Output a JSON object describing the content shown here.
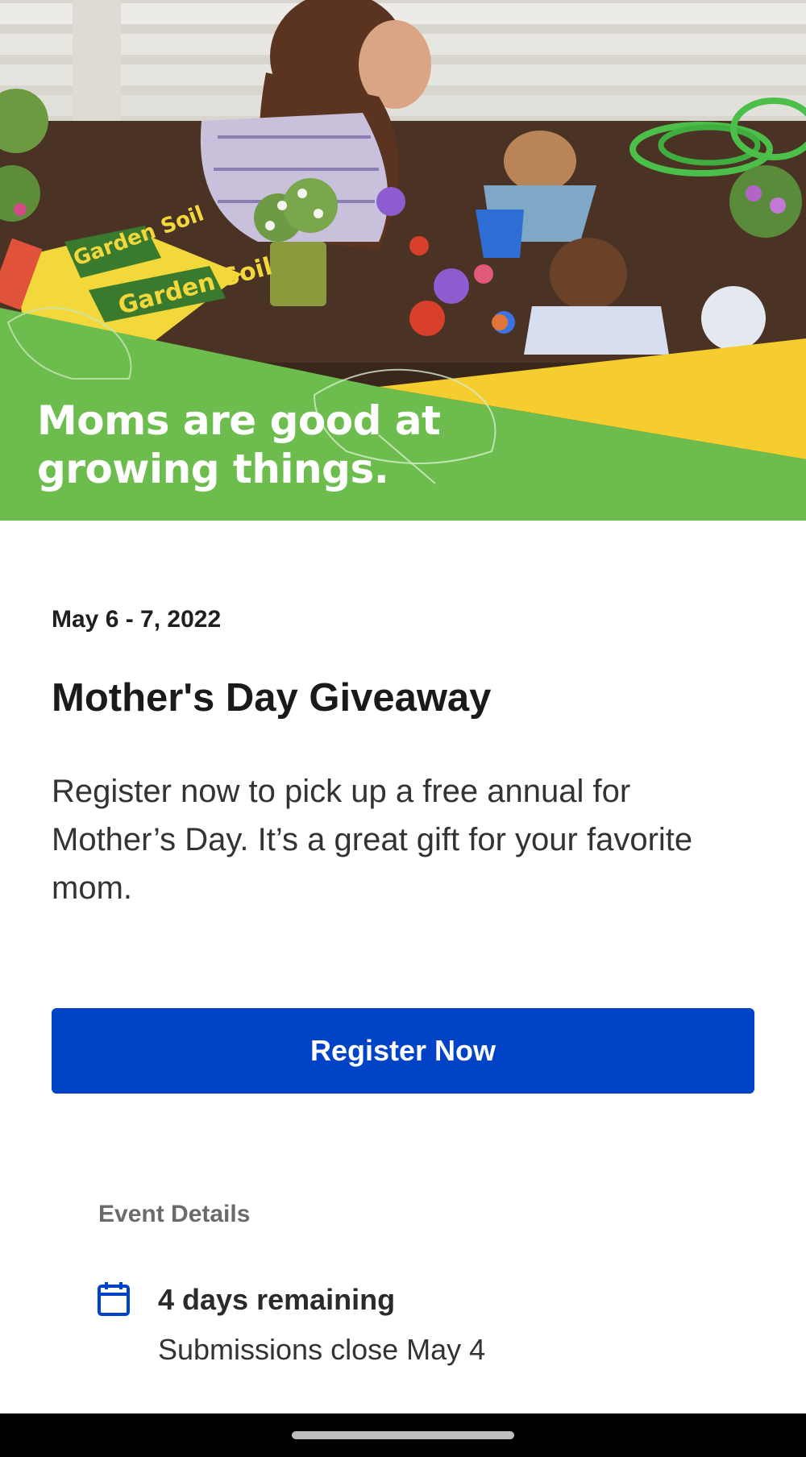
{
  "hero": {
    "headline_line1": "Moms are good at",
    "headline_line2": "growing things.",
    "bag_text_1": "Garden Soil",
    "bag_text_2": "Garden Soil"
  },
  "event": {
    "date": "May 6 - 7, 2022",
    "title": "Mother's Day Giveaway",
    "description": "Register now to pick up a free annual for Mother’s Day. It’s a great gift for your favorite mom.",
    "register_label": "Register Now"
  },
  "details": {
    "heading": "Event Details",
    "remaining": "4 days remaining",
    "closes": "Submissions close May 4",
    "icon": "calendar-icon"
  },
  "colors": {
    "primary": "#0043c6",
    "hero_green": "#6cbd4e",
    "hero_yellow": "#f5cd2e"
  }
}
